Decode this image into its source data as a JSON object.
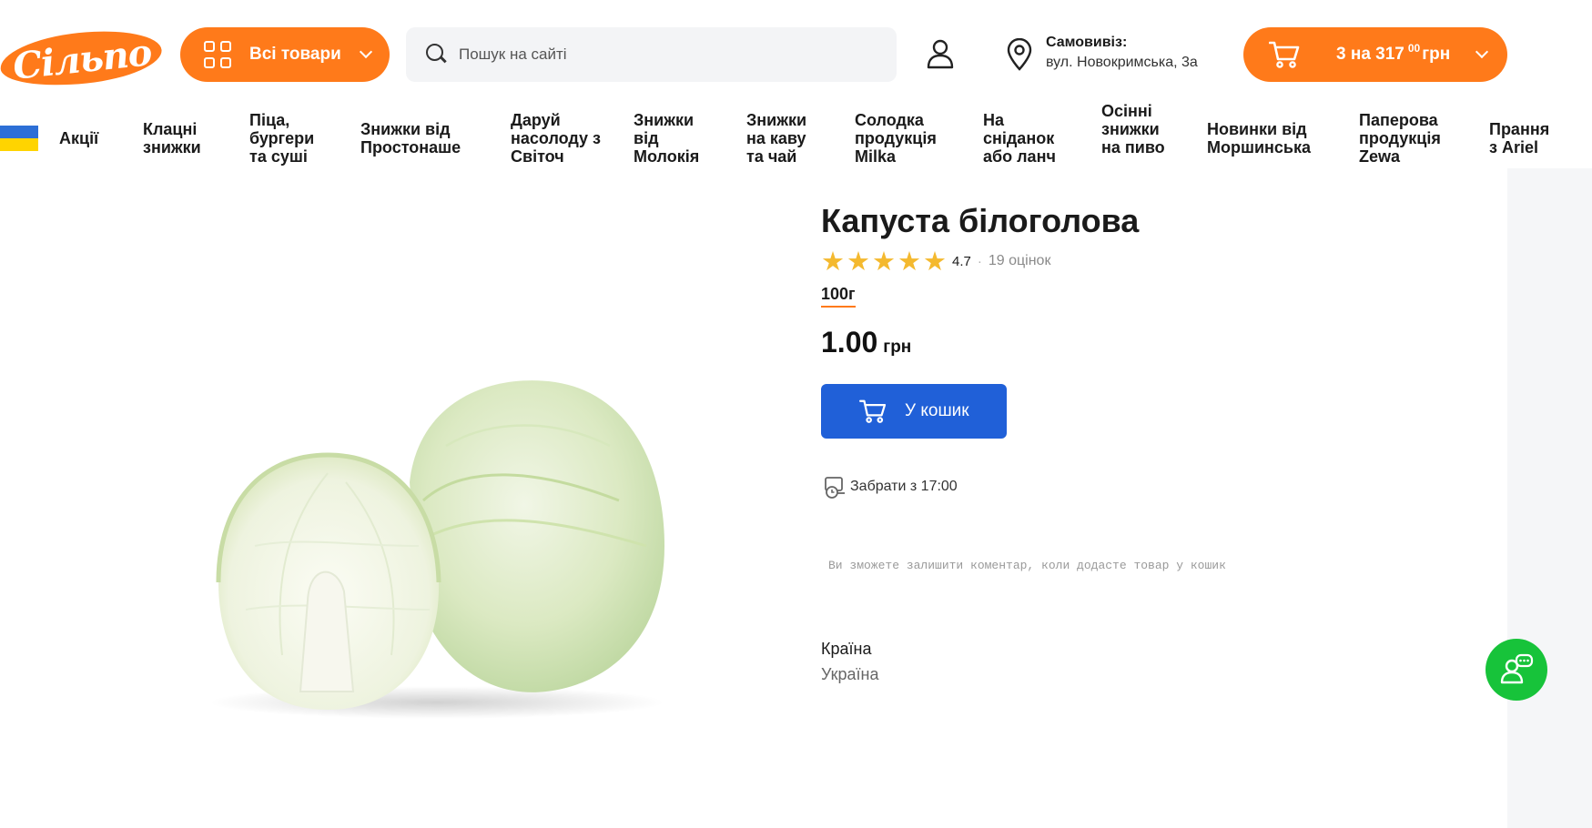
{
  "header": {
    "logo_text": "Сільпо",
    "all_goods_label": "Всі товари",
    "search": {
      "placeholder": "Пошук на сайті",
      "value": ""
    },
    "pickup": {
      "title": "Самовивіз:",
      "address": "вул. Новокримська, 3а"
    },
    "cart": {
      "count_prefix": "3 на",
      "amount_main": "317",
      "amount_cents": "00",
      "currency": "грн"
    }
  },
  "categories": [
    "Акції",
    "Клацні знижки",
    "Піца, бургери та суші",
    "Знижки від Простонаше",
    "Даруй насолоду з Світоч",
    "Знижки від Молокія",
    "Знижки на каву та чай",
    "Солодка продукція Milka",
    "На сніданок або ланч",
    "Осінні знижки на пиво",
    "Новинки від Моршинська",
    "Паперова продукція Zewa",
    "Прання з Ariel"
  ],
  "product": {
    "title": "Капуста білоголова",
    "rating": {
      "value": "4.7",
      "count_label": "19 оцінок",
      "stars": 5
    },
    "weight": "100г",
    "price": {
      "value": "1.00",
      "currency": "грн"
    },
    "add_to_cart_label": "У кошик",
    "pickup_time_label": "Забрати з 17:00",
    "comment_note": "Ви зможете залишити коментар, коли додасте товар у кошик",
    "attributes": {
      "country_label": "Країна",
      "country_value": "Україна"
    }
  },
  "colors": {
    "brand_orange": "#ff7a1a",
    "primary_blue": "#2060d8",
    "star_gold": "#f4b92f",
    "chat_green": "#17c33a"
  },
  "icons": [
    "grid-icon",
    "chevron-down-icon",
    "search-icon",
    "user-icon",
    "location-pin-icon",
    "cart-icon",
    "star-icon",
    "pickup-clock-icon",
    "chat-support-icon"
  ]
}
